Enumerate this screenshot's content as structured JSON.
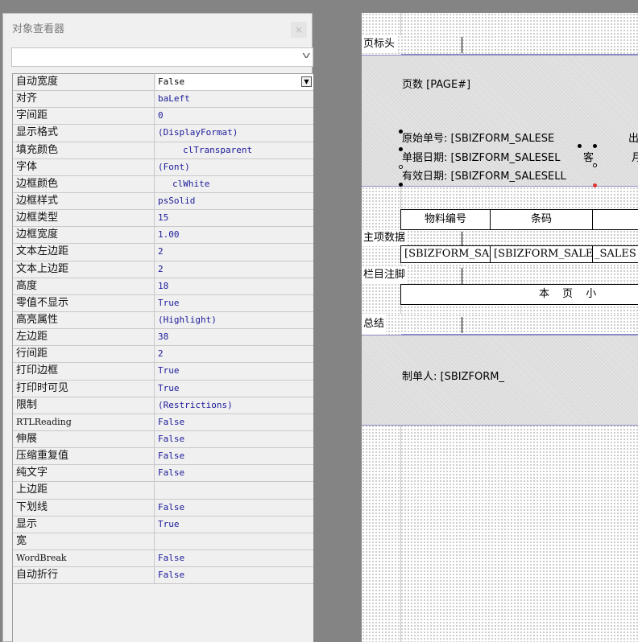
{
  "inspector": {
    "title": "对象查看器",
    "close_glyph": "×",
    "object_select_value": "",
    "properties": [
      {
        "name": "自动宽度",
        "value": "False"
      },
      {
        "name": "对齐",
        "value": "baLeft"
      },
      {
        "name": "字间距",
        "value": "0"
      },
      {
        "name": "显示格式",
        "value": "(DisplayFormat)"
      },
      {
        "name": "填充颜色",
        "value": "clTransparent"
      },
      {
        "name": "字体",
        "value": "(Font)"
      },
      {
        "name": "边框颜色",
        "value": "clWhite"
      },
      {
        "name": "边框样式",
        "value": "psSolid"
      },
      {
        "name": "边框类型",
        "value": "15"
      },
      {
        "name": "边框宽度",
        "value": "1.00"
      },
      {
        "name": "文本左边距",
        "value": "2"
      },
      {
        "name": "文本上边距",
        "value": "2"
      },
      {
        "name": "高度",
        "value": "18"
      },
      {
        "name": "零值不显示",
        "value": "True"
      },
      {
        "name": "高亮属性",
        "value": "(Highlight)"
      },
      {
        "name": "左边距",
        "value": "38"
      },
      {
        "name": "行间距",
        "value": "2"
      },
      {
        "name": "打印边框",
        "value": "True"
      },
      {
        "name": "打印时可见",
        "value": "True"
      },
      {
        "name": "限制",
        "value": "(Restrictions)"
      },
      {
        "name": "RTLReading",
        "value": "False"
      },
      {
        "name": "伸展",
        "value": "False"
      },
      {
        "name": "压缩重复值",
        "value": "False"
      },
      {
        "name": "纯文字",
        "value": "False"
      },
      {
        "name": "上边距",
        "value": ""
      },
      {
        "name": "下划线",
        "value": "False"
      },
      {
        "name": "显示",
        "value": "True"
      },
      {
        "name": "宽",
        "value": ""
      },
      {
        "name": "WordBreak",
        "value": "False"
      },
      {
        "name": "自动折行",
        "value": "False"
      }
    ]
  },
  "report": {
    "page_header": {
      "band_title": "页标头",
      "page_no": "页数 [PAGE#]",
      "order_no": "原始单号: [SBIZFORM_SALESE",
      "order_no_suffix": "出",
      "doc_date": "单据日期: [SBIZFORM_SALESEL",
      "doc_date_suffix": "客",
      "doc_date_suffix2": "月",
      "valid_date": "有效日期: [SBIZFORM_SALESELL"
    },
    "column_headers": [
      "物料编号",
      "条码"
    ],
    "master_data": {
      "band_title": "主项数据",
      "cells": [
        "[SBIZFORM_SA",
        "[SBIZFORM_SALE",
        "_SALES"
      ]
    },
    "column_footer": {
      "band_title": "栏目注脚",
      "subtotal_label": "本  页  小"
    },
    "summary": {
      "band_title": "总结",
      "maker": "制单人: [SBIZFORM_"
    }
  }
}
